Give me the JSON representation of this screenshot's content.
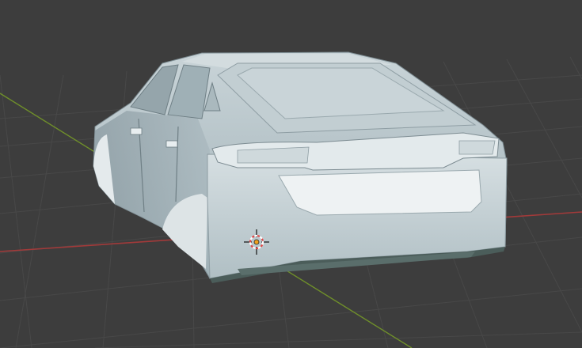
{
  "viewport": {
    "shading": "solid",
    "background_color": "#3d3d3d",
    "grid_color": "#474747",
    "x_axis_color": "#a23a3a",
    "y_axis_color": "#6f8f2a"
  },
  "scene": {
    "object_type": "car-body-mesh",
    "object_color": "#b7c4c9",
    "cursor_icon": "3d-cursor-icon"
  }
}
